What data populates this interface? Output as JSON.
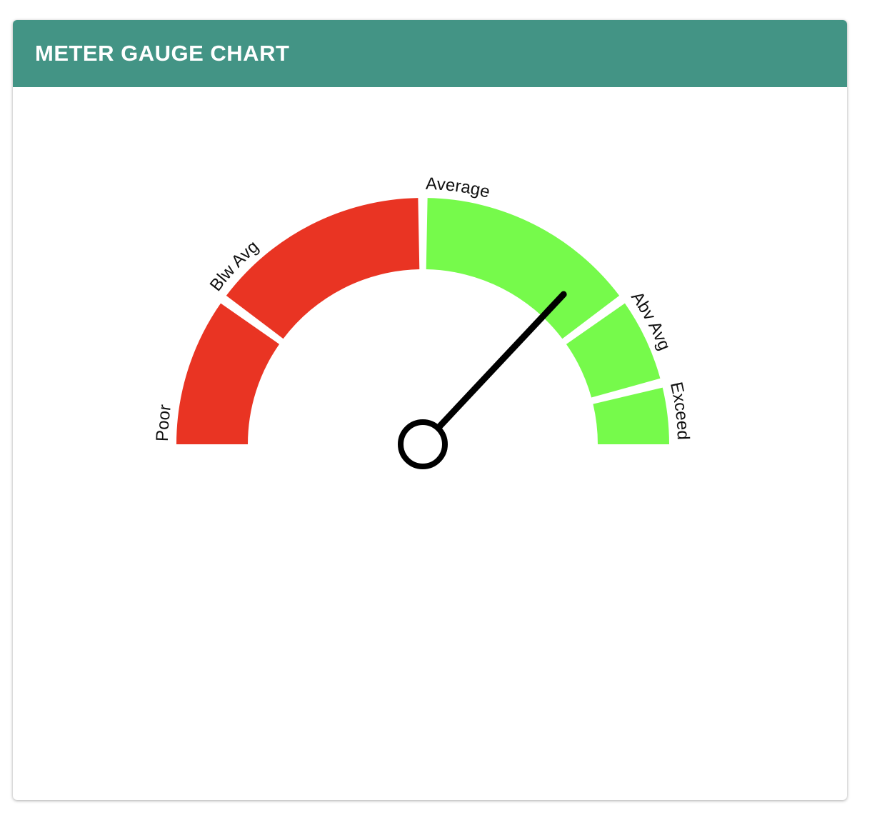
{
  "header": {
    "title": "METER GAUGE CHART"
  },
  "chart_data": {
    "type": "gauge",
    "range": [
      0,
      5
    ],
    "value": 3.7,
    "bands": [
      {
        "label": "Poor",
        "from": 0,
        "to": 1,
        "color": "#e93423"
      },
      {
        "label": "Blw Avg",
        "from": 1,
        "to": 2.5,
        "color": "#e93423"
      },
      {
        "label": "Average",
        "from": 2.5,
        "to": 4,
        "color": "#76fa4b"
      },
      {
        "label": "Abv Avg",
        "from": 4,
        "to": 4.6,
        "color": "#76fa4b"
      },
      {
        "label": "Exceed",
        "from": 4.6,
        "to": 5,
        "color": "#76fa4b"
      }
    ]
  },
  "colors": {
    "header_bg": "#439485",
    "needle": "#000000",
    "separator": "#ffffff"
  }
}
